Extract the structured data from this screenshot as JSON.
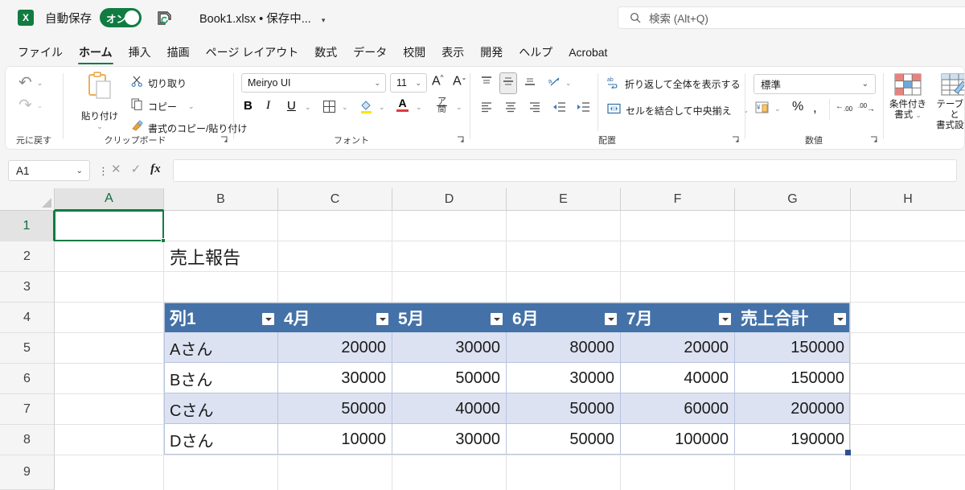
{
  "titlebar": {
    "app_icon": "excel-icon",
    "autosave_label": "自動保存",
    "autosave_state": "オン",
    "save_status_icon": "save-sync-icon",
    "document_title": "Book1.xlsx • 保存中...",
    "title_caret": "▾"
  },
  "search": {
    "icon": "search-icon",
    "placeholder": "検索 (Alt+Q)"
  },
  "tabs": [
    {
      "label": "ファイル",
      "active": false
    },
    {
      "label": "ホーム",
      "active": true
    },
    {
      "label": "挿入",
      "active": false
    },
    {
      "label": "描画",
      "active": false
    },
    {
      "label": "ページ レイアウト",
      "active": false
    },
    {
      "label": "数式",
      "active": false
    },
    {
      "label": "データ",
      "active": false
    },
    {
      "label": "校閲",
      "active": false
    },
    {
      "label": "表示",
      "active": false
    },
    {
      "label": "開発",
      "active": false
    },
    {
      "label": "ヘルプ",
      "active": false
    },
    {
      "label": "Acrobat",
      "active": false
    }
  ],
  "ribbon": {
    "undo_group": {
      "label": "元に戻す",
      "undo_icon": "undo-arrow-icon",
      "redo_icon": "redo-arrow-icon",
      "caret": "⌄"
    },
    "clipboard_group": {
      "label": "クリップボード",
      "paste_label": "貼り付け",
      "paste_icon": "clipboard-icon",
      "cut_label": "切り取り",
      "cut_icon": "scissors-icon",
      "copy_label": "コピー",
      "copy_icon": "copy-icon",
      "format_painter_label": "書式のコピー/貼り付け",
      "format_painter_icon": "paintbrush-icon",
      "dialog_launcher": "⌐"
    },
    "font_group": {
      "label": "フォント",
      "font_name": "Meiryo UI",
      "font_size": "11",
      "grow_font_icon": "grow-font-icon",
      "shrink_font_icon": "shrink-font-icon",
      "bold": "B",
      "italic": "I",
      "underline": "U",
      "borders_icon": "borders-icon",
      "fill_color_icon": "fill-color-icon",
      "font_color_icon": "font-color-icon",
      "phonetic_icon": "phonetic-guide-icon",
      "dialog_launcher": "⌐"
    },
    "alignment_group": {
      "label": "配置",
      "align_top_icon": "align-top-icon",
      "align_middle_icon": "align-middle-icon",
      "align_bottom_icon": "align-bottom-icon",
      "orientation_icon": "text-orientation-icon",
      "wrap_text_label": "折り返して全体を表示する",
      "wrap_text_icon": "wrap-text-icon",
      "align_left_icon": "align-left-icon",
      "align_center_icon": "align-center-icon",
      "align_right_icon": "align-right-icon",
      "decrease_indent_icon": "decrease-indent-icon",
      "increase_indent_icon": "increase-indent-icon",
      "merge_center_label": "セルを結合して中央揃え",
      "merge_center_icon": "merge-cells-icon",
      "dialog_launcher": "⌐"
    },
    "number_group": {
      "label": "数値",
      "format_value": "標準",
      "accounting_icon": "accounting-format-icon",
      "percent_icon": "percent-style-icon",
      "comma_icon": "comma-style-icon",
      "decrease_decimal_icon": "decrease-decimal-icon",
      "increase_decimal_icon": "increase-decimal-icon",
      "dialog_launcher": "⌐"
    },
    "styles_group": {
      "conditional_format_label_1": "条件付き",
      "conditional_format_label_2": "書式",
      "conditional_format_icon": "conditional-formatting-icon",
      "table_style_label_1": "テーブルと",
      "table_style_label_2": "書式設定",
      "table_style_icon": "format-as-table-icon"
    }
  },
  "formula_bar": {
    "name_box_value": "A1",
    "name_box_caret": "⌄",
    "cancel_icon": "cancel-icon",
    "enter_icon": "confirm-check-icon",
    "function_icon": "fx",
    "formula_value": ""
  },
  "grid": {
    "column_headers": [
      "A",
      "B",
      "C",
      "D",
      "E",
      "F",
      "G",
      "H"
    ],
    "row_headers": [
      "1",
      "2",
      "3",
      "4",
      "5",
      "6",
      "7",
      "8",
      "9"
    ],
    "selected_cell": "A1",
    "selected_column": "A",
    "selected_row": "1",
    "title_cell": {
      "ref": "B2",
      "value": "売上報告"
    }
  },
  "table": {
    "name": "sales-table",
    "range": "B4:G8",
    "headers": [
      "列1",
      "4月",
      "5月",
      "6月",
      "7月",
      "売上合計"
    ],
    "header_bg": "#4472A8",
    "band_bg": "#DCE2F1",
    "rows": [
      {
        "name": "Aさん",
        "values": [
          "20000",
          "30000",
          "80000",
          "20000",
          "150000"
        ]
      },
      {
        "name": "Bさん",
        "values": [
          "30000",
          "50000",
          "30000",
          "40000",
          "150000"
        ]
      },
      {
        "name": "Cさん",
        "values": [
          "50000",
          "40000",
          "50000",
          "60000",
          "200000"
        ]
      },
      {
        "name": "Dさん",
        "values": [
          "10000",
          "30000",
          "50000",
          "100000",
          "190000"
        ]
      }
    ],
    "filter_icon": "filter-dropdown-icon",
    "resize_handle_icon": "table-resize-handle"
  }
}
